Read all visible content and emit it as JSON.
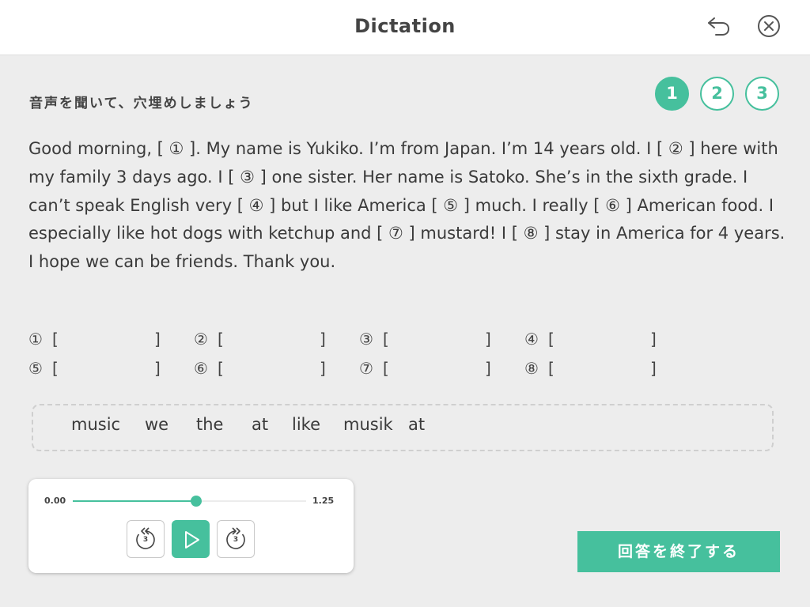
{
  "header": {
    "title": "Dictation",
    "back_icon": "undo-arrow-icon",
    "close_icon": "close-circle-icon"
  },
  "instruction": "音声を聞いて、穴埋めしましょう",
  "steps": [
    "1",
    "2",
    "3"
  ],
  "active_step": 1,
  "passage": "Good morning, [ ① ]. My name is Yukiko. I’m from Japan. I’m 14 years old. I  [ ② ] here with my family 3 days ago. I [ ③ ] one sister. Her name is Satoko. She’s in the sixth grade. I can’t speak English very [ ④ ] but I like America [ ⑤ ] much. I really [ ⑥ ] American food. I especially like hot dogs with ketchup and [ ⑦ ] mustard! I [ ⑧ ] stay in America for 4 years. I hope we can be friends. Thank you.",
  "answers": [
    {
      "num": "①",
      "open": "[",
      "close": "]"
    },
    {
      "num": "②",
      "open": "[",
      "close": "]"
    },
    {
      "num": "③",
      "open": "[",
      "close": "]"
    },
    {
      "num": "④",
      "open": "[",
      "close": "]"
    },
    {
      "num": "⑤",
      "open": "[",
      "close": "]"
    },
    {
      "num": "⑥",
      "open": "[",
      "close": "]"
    },
    {
      "num": "⑦",
      "open": "[",
      "close": "]"
    },
    {
      "num": "⑧",
      "open": "[",
      "close": "]"
    }
  ],
  "word_bank": [
    "music",
    "we",
    "the",
    "at",
    "like",
    "musik",
    "at"
  ],
  "player": {
    "time_start": "0.00",
    "time_end": "1.25",
    "progress": 0.53,
    "rewind_seconds": "3",
    "forward_seconds": "3",
    "rewind_icon": "rewind-3-icon",
    "play_icon": "play-icon",
    "forward_icon": "forward-3-icon"
  },
  "submit_label": "回答を終了する",
  "colors": {
    "accent": "#46c09d",
    "background": "#ededed",
    "header": "#ffffff"
  }
}
